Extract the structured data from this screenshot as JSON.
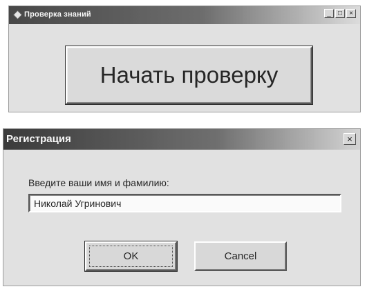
{
  "main_window": {
    "title": "Проверка знаний",
    "controls": {
      "minimize": "_",
      "maximize": "□",
      "close": "×"
    },
    "start_button_label": "Начать проверку"
  },
  "dialog": {
    "title": "Регистрация",
    "close": "×",
    "prompt": "Введите ваши имя и фамилию:",
    "name_value": "Николай Угринович",
    "ok_label": "OK",
    "cancel_label": "Cancel"
  }
}
